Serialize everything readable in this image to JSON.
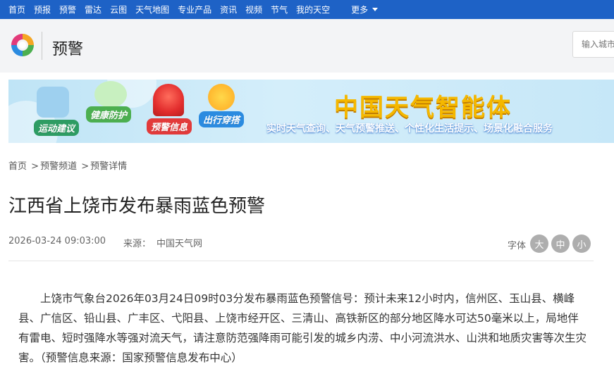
{
  "topnav": {
    "items": [
      "首页",
      "预报",
      "预警",
      "雷达",
      "云图",
      "天气地图",
      "专业产品",
      "资讯",
      "视频",
      "节气",
      "我的天空"
    ],
    "more_label": "更多"
  },
  "header": {
    "section_title": "预警",
    "search_placeholder": "输入城市"
  },
  "banner": {
    "chips": {
      "exercise": "运动建议",
      "health": "健康防护",
      "warning": "预警信息",
      "travel": "出行穿搭"
    },
    "brand": "中国天气智能体",
    "brand_sub": "实时天气查询、天气预警推送、个性化生活提示、场景化融合服务"
  },
  "breadcrumb": {
    "home": "首页",
    "channel": "预警频道",
    "current": "预警详情"
  },
  "article": {
    "title": "江西省上饶市发布暴雨蓝色预警",
    "date": "2026-03-24 09:03:00",
    "source_label": "来源：",
    "source": "中国天气网",
    "font_label": "字体",
    "font_sizes": [
      "大",
      "中",
      "小"
    ],
    "body": "上饶市气象台2026年03月24日09时03分发布暴雨蓝色预警信号：预计未来12小时内，信州区、玉山县、横峰县、广信区、铅山县、广丰区、弋阳县、上饶市经开区、三清山、高铁新区的部分地区降水可达50毫米以上，局地伴有雷电、短时强降水等强对流天气，请注意防范强降雨可能引发的城乡内涝、中小河流洪水、山洪和地质灾害等次生灾害。（预警信息来源：国家预警信息发布中心）"
  },
  "colors": {
    "nav_bg": "#1e62c6",
    "header_bg": "#f3f4f6",
    "brand_yellow": "#f5b800"
  }
}
